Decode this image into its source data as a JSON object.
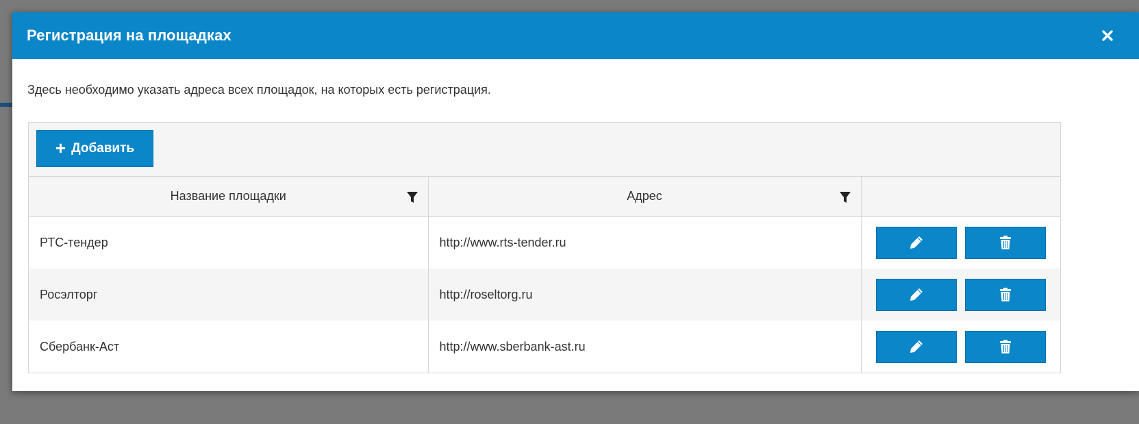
{
  "dialog": {
    "title": "Регистрация на площадках",
    "close_icon": "close-icon",
    "intro": "Здесь необходимо указать адреса всех площадок, на которых есть регистрация."
  },
  "toolbar": {
    "add_label": "Добавить",
    "add_icon": "plus-icon"
  },
  "columns": [
    {
      "label": "Название площадки",
      "filter_icon": "filter-icon"
    },
    {
      "label": "Адрес",
      "filter_icon": "filter-icon"
    },
    {
      "label": ""
    }
  ],
  "rows": [
    {
      "name": "РТС-тендер",
      "address": "http://www.rts-tender.ru"
    },
    {
      "name": "Росэлторг",
      "address": "http://roseltorg.ru"
    },
    {
      "name": "Сбербанк-Аст",
      "address": "http://www.sberbank-ast.ru"
    }
  ],
  "row_actions": {
    "edit_icon": "pencil-icon",
    "delete_icon": "trash-icon"
  },
  "colors": {
    "accent": "#0a86c9",
    "header_bg": "#f5f5f5",
    "border": "#d6d6d6",
    "overlay": "#7a7a7a"
  }
}
